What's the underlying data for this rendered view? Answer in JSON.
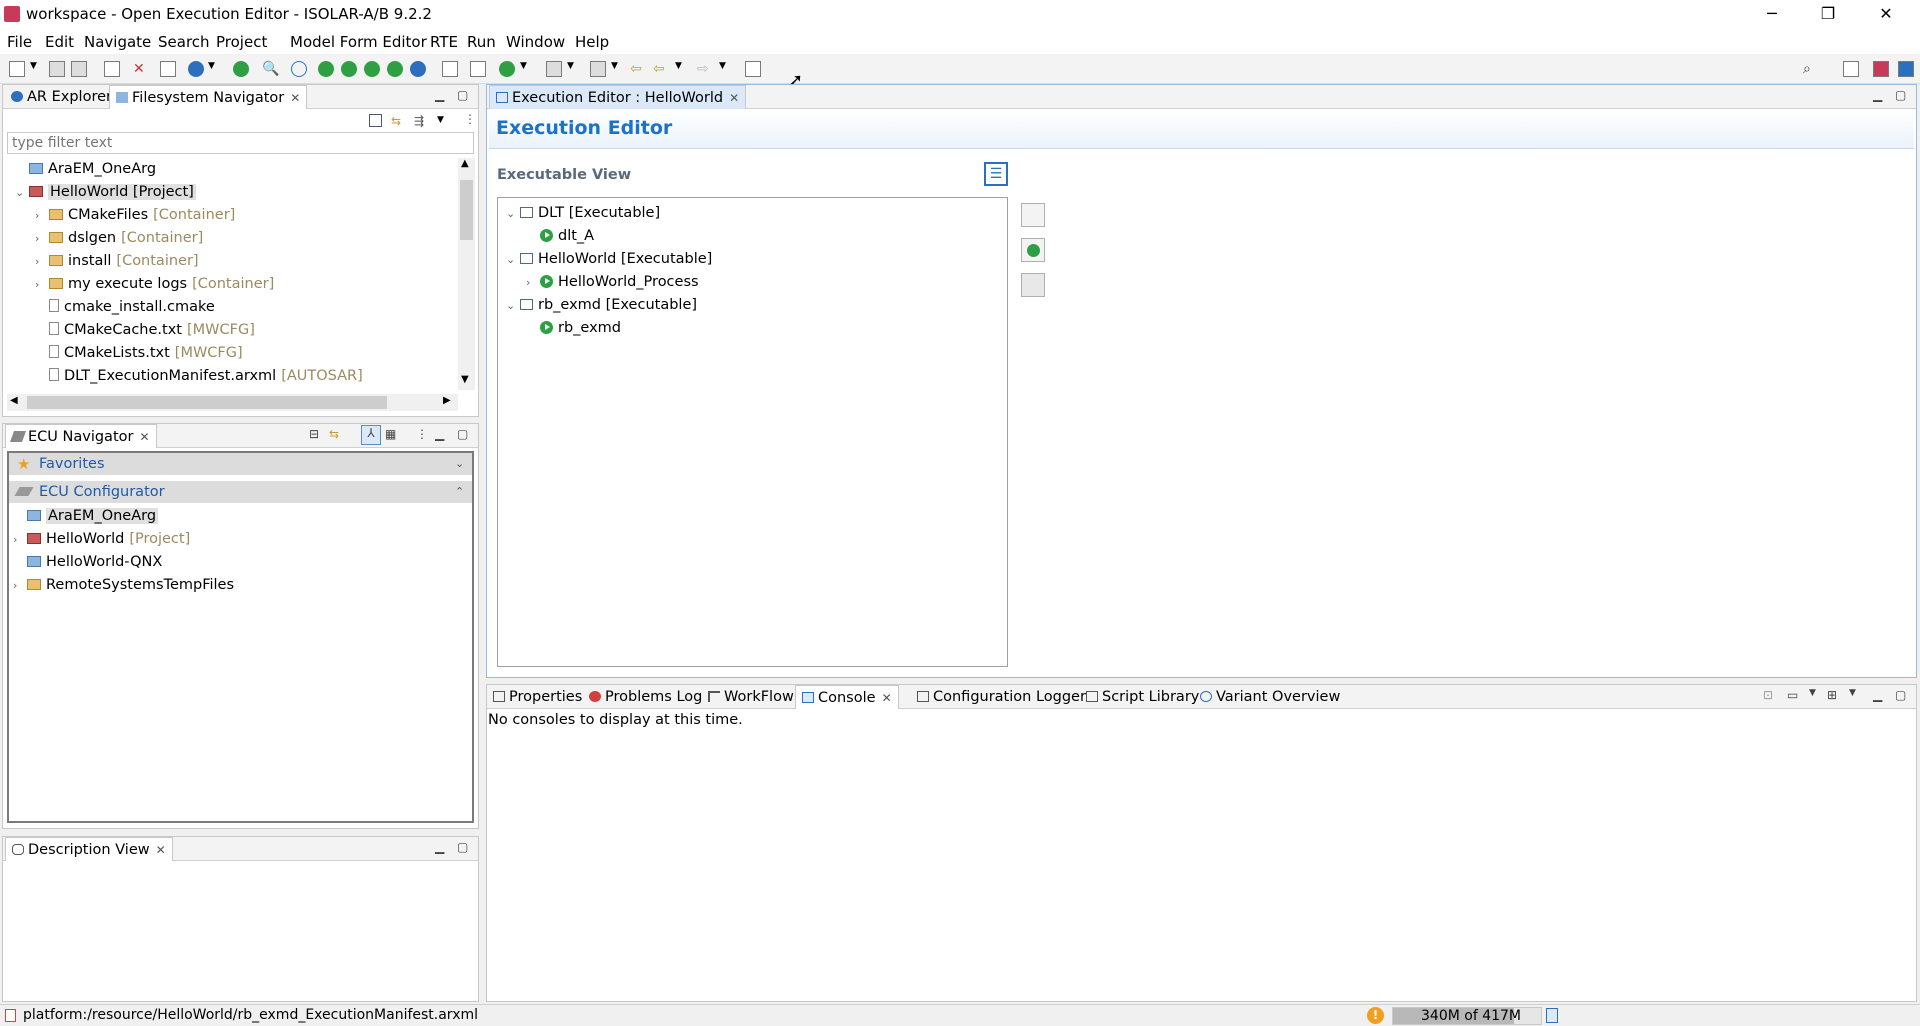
{
  "window": {
    "title": "workspace - Open Execution Editor - ISOLAR-A/B 9.2.2",
    "minimize": "─",
    "maximize": "❐",
    "close": "✕"
  },
  "menu": [
    "File",
    "Edit",
    "Navigate",
    "Search",
    "Project",
    "Model Form Editor",
    "RTE",
    "Run",
    "Window",
    "Help"
  ],
  "top_left_panel": {
    "tabs": [
      "AR Explorer",
      "Filesystem Navigator"
    ],
    "filter_placeholder": "type filter text",
    "tree": [
      {
        "name": "AraEM_OneArg",
        "tag": "",
        "icon": "blue-folder",
        "indent": 0,
        "chevron": ""
      },
      {
        "name": "HelloWorld [Project]",
        "tag": "",
        "icon": "project",
        "indent": 0,
        "chevron": "down",
        "selected": true
      },
      {
        "name": "CMakeFiles",
        "tag": "[Container]",
        "icon": "folder",
        "indent": 1,
        "chevron": "right"
      },
      {
        "name": "dslgen",
        "tag": "[Container]",
        "icon": "folder",
        "indent": 1,
        "chevron": "right"
      },
      {
        "name": "install",
        "tag": "[Container]",
        "icon": "folder",
        "indent": 1,
        "chevron": "right"
      },
      {
        "name": "my execute logs",
        "tag": "[Container]",
        "icon": "folder",
        "indent": 1,
        "chevron": "right"
      },
      {
        "name": "cmake_install.cmake",
        "tag": "",
        "icon": "file",
        "indent": 1,
        "chevron": ""
      },
      {
        "name": "CMakeCache.txt",
        "tag": "[MWCFG]",
        "icon": "file",
        "indent": 1,
        "chevron": ""
      },
      {
        "name": "CMakeLists.txt",
        "tag": "[MWCFG]",
        "icon": "file",
        "indent": 1,
        "chevron": ""
      },
      {
        "name": "DLT_ExecutionManifest.arxml",
        "tag": "[AUTOSAR]",
        "icon": "file",
        "indent": 1,
        "chevron": ""
      }
    ]
  },
  "ecu_navigator": {
    "tab": "ECU Navigator",
    "favorites": "Favorites",
    "configurator": "ECU Configurator",
    "tree": [
      {
        "name": "AraEM_OneArg",
        "tag": "",
        "icon": "blue-folder",
        "chevron": "",
        "selected": true
      },
      {
        "name": "HelloWorld",
        "tag": "[Project]",
        "icon": "project",
        "chevron": "right"
      },
      {
        "name": "HelloWorld-QNX",
        "tag": "",
        "icon": "blue-folder",
        "chevron": ""
      },
      {
        "name": "RemoteSystemsTempFiles",
        "tag": "",
        "icon": "folder",
        "chevron": "right"
      }
    ]
  },
  "description_view": {
    "tab": "Description View"
  },
  "editor": {
    "tab": "Execution Editor : HelloWorld",
    "heading": "Execution Editor",
    "section": "Executable View",
    "tree": [
      {
        "label": "DLT [Executable]",
        "type": "exe",
        "indent": 0,
        "chevron": "down"
      },
      {
        "label": "dlt_A",
        "type": "process",
        "indent": 1,
        "chevron": ""
      },
      {
        "label": "HelloWorld [Executable]",
        "type": "exe",
        "indent": 0,
        "chevron": "down"
      },
      {
        "label": "HelloWorld_Process",
        "type": "process",
        "indent": 1,
        "chevron": "right"
      },
      {
        "label": "rb_exmd [Executable]",
        "type": "exe",
        "indent": 0,
        "chevron": "down"
      },
      {
        "label": "rb_exmd",
        "type": "process",
        "indent": 1,
        "chevron": ""
      }
    ]
  },
  "bottom_panel": {
    "tabs": [
      "Properties",
      "Problems Log",
      "WorkFlow",
      "Console",
      "Configuration Logger",
      "Script Library",
      "Variant Overview"
    ],
    "active_tab": "Console",
    "message": "No consoles to display at this time."
  },
  "status": {
    "path": "platform:/resource/HelloWorld/rb_exmd_ExecutionManifest.arxml",
    "memory": "340M of 417M",
    "memory_fraction": 0.815
  },
  "colors": {
    "accent": "#1f5aa8",
    "heading_bg": "#eaf2fb",
    "heading_text": "#1a73c8"
  }
}
